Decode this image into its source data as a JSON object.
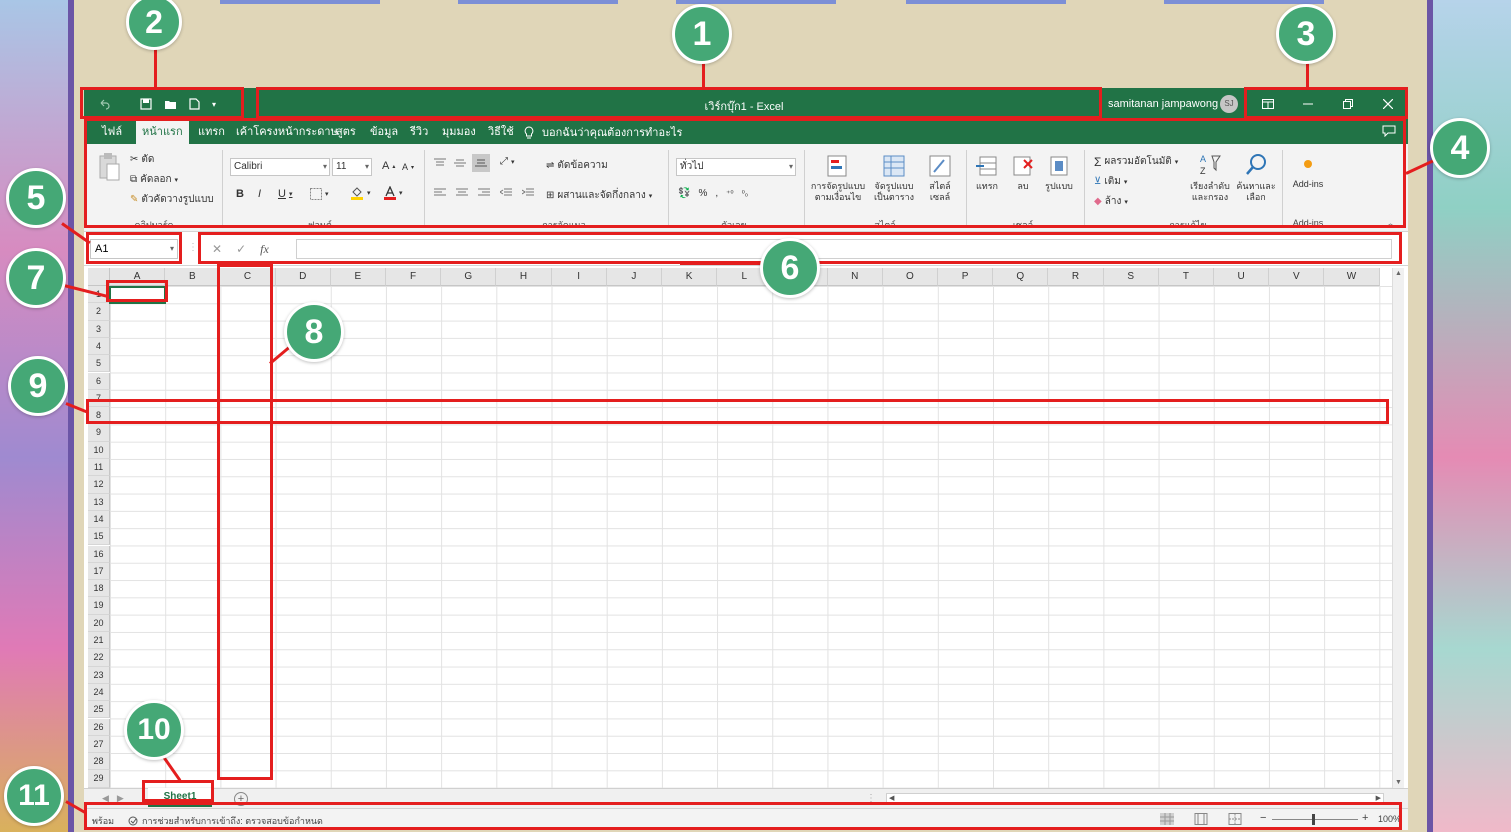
{
  "window": {
    "title": "เวิร์กบุ๊ก1  -  Excel",
    "user_name": "samitanan jampawong",
    "user_initials": "SJ"
  },
  "ribbon_tabs": [
    "ไฟล์",
    "หน้าแรก",
    "แทรก",
    "เค้าโครงหน้ากระดาษ",
    "สูตร",
    "ข้อมูล",
    "รีวิว",
    "มุมมอง",
    "วิธีใช้"
  ],
  "tell_me": "บอกฉันว่าคุณต้องการทำอะไร",
  "ribbon": {
    "clipboard": {
      "cut": "ตัด",
      "copy": "คัดลอก",
      "painter": "ตัวคัดวางรูปแบบ",
      "label": "คลิปบอร์ด"
    },
    "font": {
      "name": "Calibri",
      "size": "11",
      "label": "ฟอนต์",
      "bold": "B",
      "italic": "I",
      "underline": "U",
      "grow": "A",
      "shrink": "A"
    },
    "alignment": {
      "wrap": "ตัดข้อความ",
      "merge": "ผสานและจัดกึ่งกลาง",
      "label": "การจัดแนว"
    },
    "number": {
      "format": "ทั่วไป",
      "label": "ตัวเลข",
      "percent": "%",
      "comma": ","
    },
    "styles": {
      "conditional": "การจัดรูปแบบ\nตามเงื่อนไข",
      "table": "จัดรูปแบบ\nเป็นตาราง",
      "cell": "สไตล์\nเซลล์",
      "label": "สไตล์"
    },
    "cells": {
      "insert": "แทรก",
      "delete": "ลบ",
      "format": "รูปแบบ",
      "label": "เซลล์"
    },
    "editing": {
      "autosum": "ผลรวมอัตโนมัติ",
      "fill": "เติม",
      "clear": "ล้าง",
      "sort": "เรียงลำดับ\nและกรอง",
      "find": "ค้นหาและ\nเลือก",
      "label": "การแก้ไข"
    },
    "addins": {
      "button": "Add-ins",
      "label": "Add-ins"
    }
  },
  "formula_bar": {
    "name_box": "A1",
    "fx": "fx",
    "cancel": "✕",
    "enter": "✓"
  },
  "columns": [
    "A",
    "B",
    "C",
    "D",
    "E",
    "F",
    "G",
    "H",
    "I",
    "J",
    "K",
    "L",
    "M",
    "N",
    "O",
    "P",
    "Q",
    "R",
    "S",
    "T",
    "U",
    "V",
    "W"
  ],
  "rows": [
    "1",
    "2",
    "3",
    "4",
    "5",
    "6",
    "7",
    "8",
    "9",
    "10",
    "11",
    "12",
    "13",
    "14",
    "15",
    "16",
    "17",
    "18",
    "19",
    "20",
    "21",
    "22",
    "23",
    "24",
    "25",
    "26",
    "27",
    "28",
    "29"
  ],
  "sheet_tabs": [
    "Sheet1"
  ],
  "add_sheet": "+",
  "status": {
    "ready": "พร้อม",
    "accessibility": "การช่วยสำหรับการเข้าถึง: ตรวจสอบข้อกำหนด",
    "zoom": "100%",
    "minus": "−",
    "plus": "+"
  },
  "annotations": [
    "1",
    "2",
    "3",
    "4",
    "5",
    "6",
    "7",
    "8",
    "9",
    "10",
    "11"
  ],
  "colors": {
    "excel_green": "#217346",
    "annotation_red": "#e41e1e",
    "badge_green": "#45a876"
  }
}
